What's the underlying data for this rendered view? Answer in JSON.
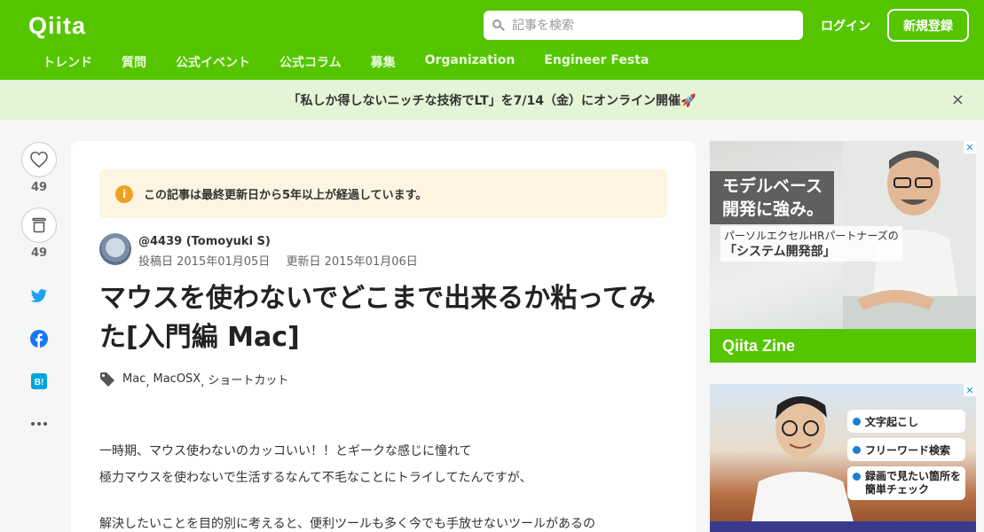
{
  "header": {
    "logo": "Qiita",
    "search_placeholder": "記事を検索",
    "login_label": "ログイン",
    "signup_label": "新規登録",
    "nav": [
      "トレンド",
      "質問",
      "公式イベント",
      "公式コラム",
      "募集",
      "Organization",
      "Engineer Festa"
    ],
    "brand_color": "#55c500"
  },
  "announcement": {
    "text": "「私しか得しないニッチな技術でLT」を7/14（金）にオンライン開催🚀",
    "close": "×"
  },
  "side_actions": {
    "like_count": "49",
    "stock_count": "49"
  },
  "article": {
    "notice": "この記事は最終更新日から5年以上が経過しています。",
    "notice_icon": "i",
    "author": "@4439 (Tomoyuki S)",
    "posted": "投稿日 2015年01月05日",
    "updated": "更新日 2015年01月06日",
    "title": "マウスを使わないでどこまで出来るか粘ってみた[入門編 Mac]",
    "tags": [
      "Mac",
      "MacOSX",
      "ショートカット"
    ],
    "body": [
      "一時期、マウス使わないのカッコいい！！とギークな感じに憧れて",
      "極力マウスを使わないで生活するなんて不毛なことにトライしてたんですが、",
      "解決したいことを目的別に考えると、便利ツールも多く今でも手放せないツールがあるの"
    ]
  },
  "ads": {
    "ad1": {
      "headline": "モデルベース開発に強み。",
      "sub_line1": "パーソルエクセルHRパートナーズの",
      "sub_line2": "「システム開発部」",
      "footer": "Qiita Zine",
      "close": "✕"
    },
    "ad2": {
      "pill1": "文字起こし",
      "pill2": "フリーワード検索",
      "pill3": "録画で見たい箇所を簡単チェック",
      "close": "✕"
    }
  }
}
